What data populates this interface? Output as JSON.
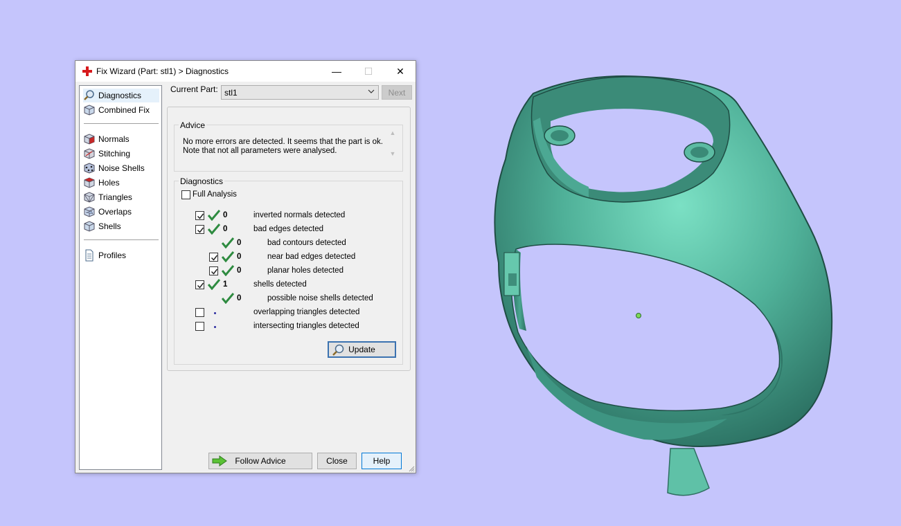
{
  "window": {
    "title": "Fix Wizard (Part: stl1) > Diagnostics",
    "minimize_glyph": "—",
    "maximize_glyph": "☐",
    "close_glyph": "✕"
  },
  "sidebar": {
    "items": [
      {
        "label": "Diagnostics",
        "icon": "magnifier-icon"
      },
      {
        "label": "Combined Fix",
        "icon": "combined-fix-cube-icon"
      },
      {
        "label": "Normals",
        "icon": "normals-cube-icon"
      },
      {
        "label": "Stitching",
        "icon": "stitching-cube-icon"
      },
      {
        "label": "Noise Shells",
        "icon": "noise-shells-icon"
      },
      {
        "label": "Holes",
        "icon": "holes-cube-icon"
      },
      {
        "label": "Triangles",
        "icon": "triangles-cube-icon"
      },
      {
        "label": "Overlaps",
        "icon": "overlaps-cube-icon"
      },
      {
        "label": "Shells",
        "icon": "shells-cube-icon"
      },
      {
        "label": "Profiles",
        "icon": "profiles-document-icon"
      }
    ]
  },
  "header": {
    "current_part_label": "Current Part:",
    "current_part_value": "stl1",
    "next_label": "Next"
  },
  "advice": {
    "label": "Advice",
    "line1": "No more errors are detected. It seems that the part is ok.",
    "line2": "Note that not all parameters were analysed."
  },
  "diagnostics": {
    "label": "Diagnostics",
    "full_analysis_label": "Full Analysis",
    "rows": [
      {
        "count": "0",
        "label": "inverted normals detected"
      },
      {
        "count": "0",
        "label": "bad edges detected"
      },
      {
        "count": "0",
        "label": "bad contours detected"
      },
      {
        "count": "0",
        "label": "near bad edges detected"
      },
      {
        "count": "0",
        "label": "planar holes detected"
      },
      {
        "count": "1",
        "label": "shells detected"
      },
      {
        "count": "0",
        "label": "possible noise shells detected"
      },
      {
        "count": "",
        "label": "overlapping triangles detected"
      },
      {
        "count": "",
        "label": "intersecting triangles detected"
      }
    ],
    "update_label": "Update"
  },
  "buttons": {
    "follow_advice": "Follow Advice",
    "close": "Close",
    "help": "Help"
  },
  "colors": {
    "background": "#c5c5fc",
    "model": "#5dbfa5",
    "check_green": "#2e8b40"
  }
}
